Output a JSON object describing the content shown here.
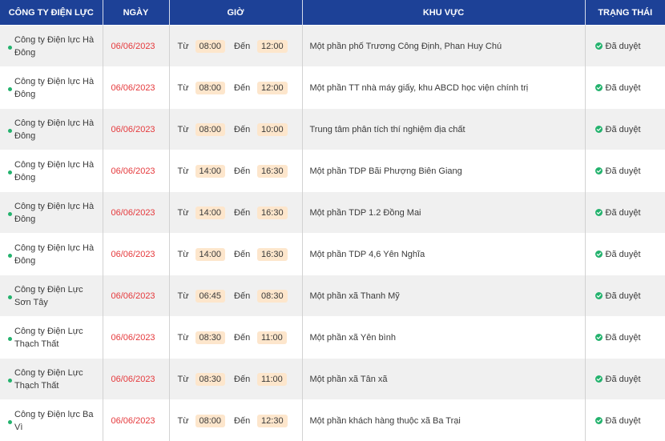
{
  "header": {
    "company": "CÔNG TY ĐIỆN LỰC",
    "date": "NGÀY",
    "time": "GIỜ",
    "area": "KHU VỰC",
    "status": "TRẠNG THÁI"
  },
  "labels": {
    "from": "Từ",
    "to": "Đến"
  },
  "colors": {
    "header_bg": "#1d4197",
    "date": "#e5393c",
    "pill": "#fde6cc",
    "status_ok": "#23b26d"
  },
  "status_icon": "check-circle-icon",
  "rows": [
    {
      "company": "Công ty Điện lực Hà Đông",
      "date": "06/06/2023",
      "start": "08:00",
      "end": "12:00",
      "area": "Một phần phố Trương Công Định, Phan Huy Chú",
      "status": "Đã duyệt"
    },
    {
      "company": "Công ty Điện lực Hà Đông",
      "date": "06/06/2023",
      "start": "08:00",
      "end": "12:00",
      "area": "Một phần TT nhà máy giấy, khu ABCD học viện chính trị",
      "status": "Đã duyệt"
    },
    {
      "company": "Công ty Điện lực Hà Đông",
      "date": "06/06/2023",
      "start": "08:00",
      "end": "10:00",
      "area": "Trung tâm phân tích thí nghiệm địa chất",
      "status": "Đã duyệt"
    },
    {
      "company": "Công ty Điện lực Hà Đông",
      "date": "06/06/2023",
      "start": "14:00",
      "end": "16:30",
      "area": "Một phần TDP Bãi Phượng Biên Giang",
      "status": "Đã duyệt"
    },
    {
      "company": "Công ty Điện lực Hà Đông",
      "date": "06/06/2023",
      "start": "14:00",
      "end": "16:30",
      "area": "Một phần TDP 1.2 Đồng Mai",
      "status": "Đã duyệt"
    },
    {
      "company": "Công ty Điện lực Hà Đông",
      "date": "06/06/2023",
      "start": "14:00",
      "end": "16:30",
      "area": "Một phần TDP 4,6 Yên Nghĩa",
      "status": "Đã duyệt"
    },
    {
      "company": "Công ty Điện Lực Sơn Tây",
      "date": "06/06/2023",
      "start": "06:45",
      "end": "08:30",
      "area": "Một phần xã Thanh Mỹ",
      "status": "Đã duyệt"
    },
    {
      "company": "Công ty Điện Lực Thạch Thất",
      "date": "06/06/2023",
      "start": "08:30",
      "end": "11:00",
      "area": "Một phần xã Yên bình",
      "status": "Đã duyệt"
    },
    {
      "company": "Công ty Điện Lực Thạch Thất",
      "date": "06/06/2023",
      "start": "08:30",
      "end": "11:00",
      "area": "Một phần xã Tân xã",
      "status": "Đã duyệt"
    },
    {
      "company": "Công ty Điện lực Ba Vì",
      "date": "06/06/2023",
      "start": "08:00",
      "end": "12:30",
      "area": "Một phần khách hàng thuộc xã Ba Trại",
      "status": "Đã duyệt"
    }
  ]
}
